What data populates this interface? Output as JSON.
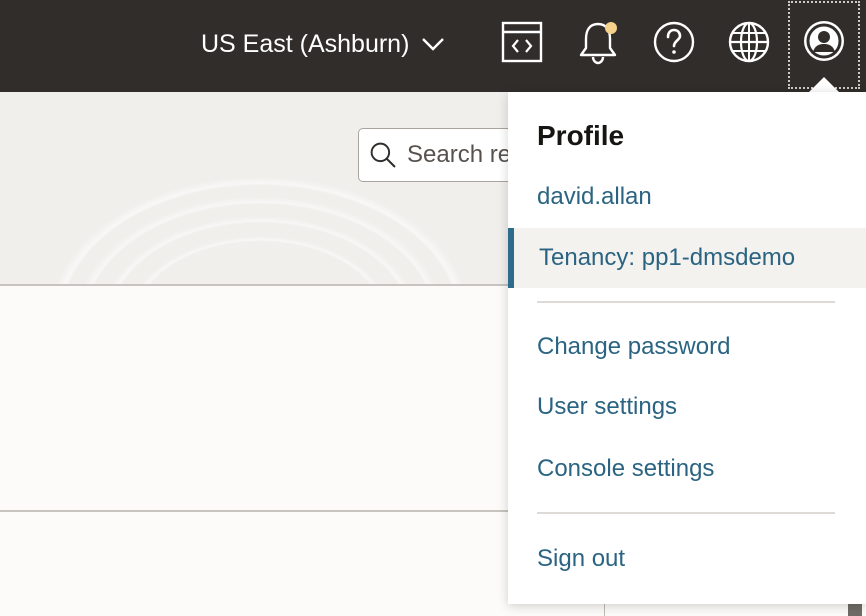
{
  "header": {
    "region_label": "US East (Ashburn)",
    "icons": [
      "code-editor-icon",
      "bell-icon",
      "help-icon",
      "globe-icon",
      "user-icon"
    ],
    "notification_dot_color": "#f5d28c"
  },
  "search": {
    "placeholder": "Search resources, services, documentation, and Marketplace"
  },
  "profile_menu": {
    "title": "Profile",
    "username": "david.allan",
    "tenancy": "Tenancy: pp1-dmsdemo",
    "change_password": "Change password",
    "user_settings": "User settings",
    "console_settings": "Console settings",
    "sign_out": "Sign out"
  },
  "colors": {
    "topbar": "#312d2a",
    "link": "#2b6482",
    "active_indicator": "#2e6c8c"
  }
}
